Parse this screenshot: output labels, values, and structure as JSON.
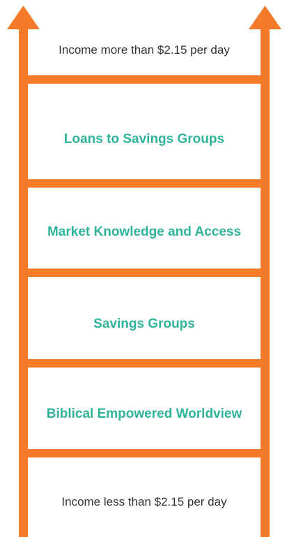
{
  "colors": {
    "ladder": "#f47b2a",
    "goal_text": "#2fb39a",
    "income_text": "#333333",
    "background": "#ffffff"
  },
  "icons": {
    "left_rail_top": "arrow-up-icon",
    "right_rail_top": "arrow-up-icon"
  },
  "ladder": {
    "top_label": "Income more than $2.15 per day",
    "steps": [
      "Loans to Savings Groups",
      "Market Knowledge and Access",
      "Savings Groups",
      "Biblical Empowered Worldview"
    ],
    "bottom_label": "Income less than $2.15 per day"
  }
}
